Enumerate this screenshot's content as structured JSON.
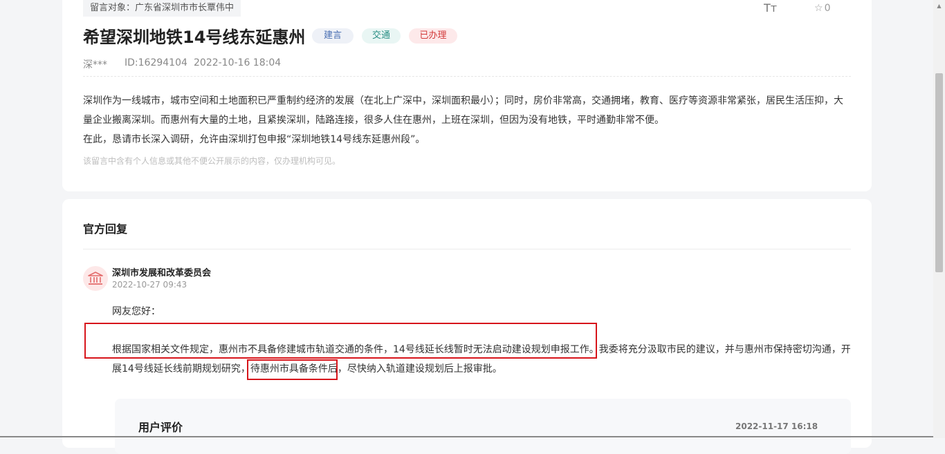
{
  "message": {
    "target_label": "留言对象：广东省深圳市市长覃伟中",
    "title": "希望深圳地铁14号线东延惠州",
    "tags": [
      "建言",
      "交通",
      "已办理"
    ],
    "author": "深***",
    "id": "ID:16294104",
    "time": "2022-10-16 18:04",
    "body": [
      "深圳作为一线城市，城市空间和土地面积已严重制约经济的发展（在北上广深中，深圳面积最小）；同时，房价非常高，交通拥堵，教育、医疗等资源非常紧张，居民生活压抑，大量企业搬离深圳。而惠州有大量的土地，且紧挨深圳，陆路连接，很多人住在惠州，上班在深圳，但因为没有地铁，平时通勤非常不便。",
      "在此，恳请市长深入调研，允许由深圳打包申报“深圳地铁14号线东延惠州段”。"
    ],
    "notice": "该留言中含有个人信息或其他不便公开展示的内容，仅办理机构可见。"
  },
  "toolbar": {
    "font_size_icon": "Tт",
    "favorite_count": "0"
  },
  "reply": {
    "heading": "官方回复",
    "org_name": "深圳市发展和改革委员会",
    "org_time": "2022-10-27 09:43",
    "greeting": "网友您好：",
    "body": "根据国家相关文件规定，惠州市不具备修建城市轨道交通的条件，14号线延长线暂时无法启动建设规划申报工作。我委将充分汲取市民的建议，并与惠州市保持密切沟通，开展14号线延长线前期规划研究，待惠州市具备条件后，尽快纳入轨道建设规划后上报审批。"
  },
  "evaluation": {
    "heading": "用户评价",
    "time": "2022-11-17 16:18"
  },
  "icons": {
    "font_size": "font-size-icon",
    "star": "star-icon",
    "government": "government-building-icon"
  },
  "colors": {
    "highlight_box": "#d7151b",
    "tag_suggestion": "#4a6fb3",
    "tag_traffic": "#2a8f85",
    "tag_done": "#d23a3a"
  }
}
